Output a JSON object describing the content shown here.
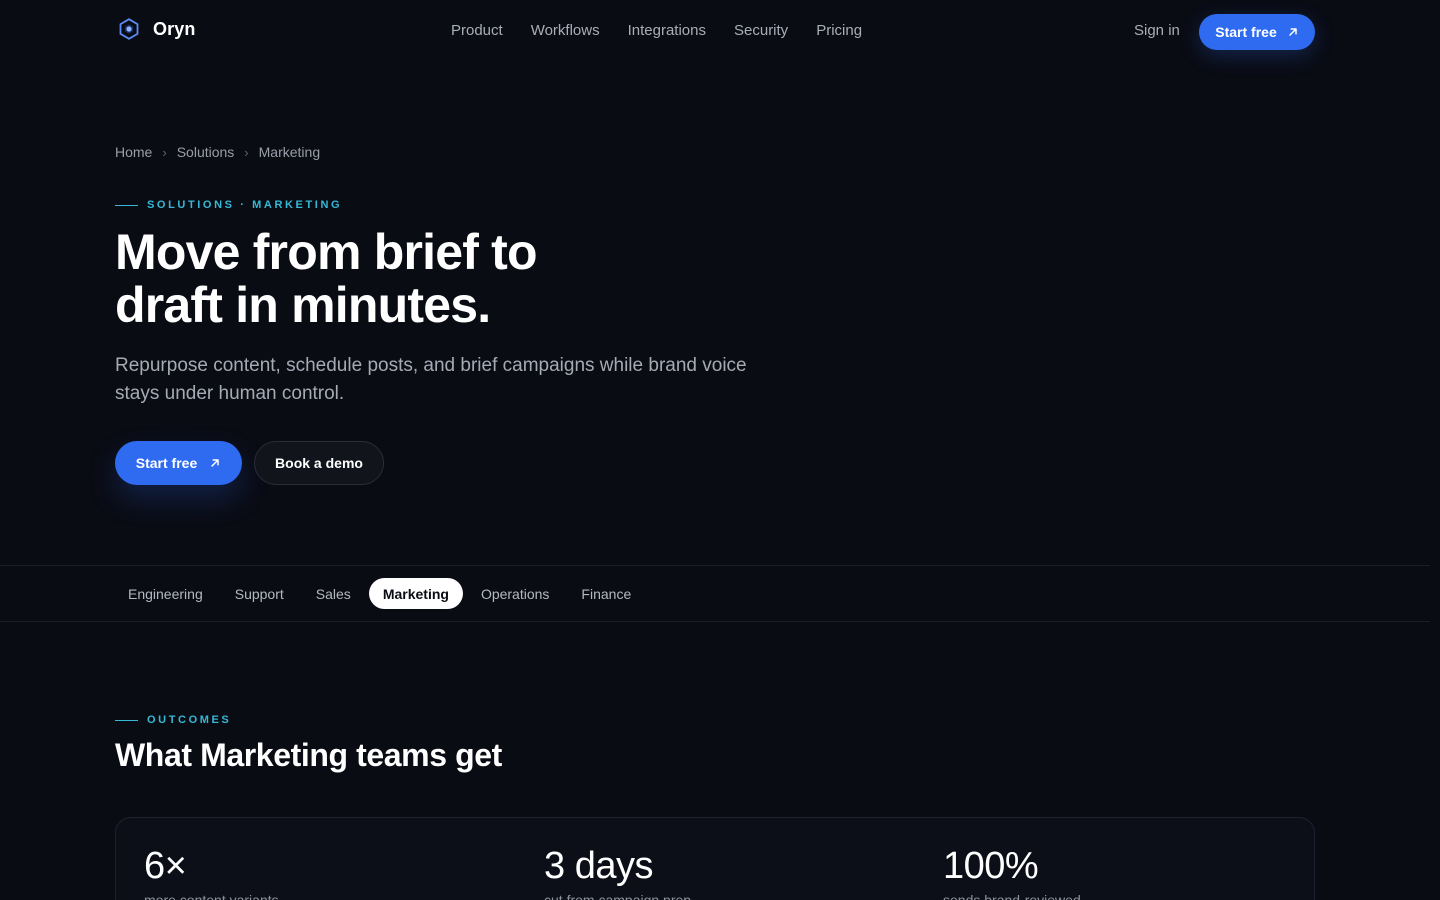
{
  "brand": {
    "name": "Oryn",
    "icon": "hexagon-logo-icon",
    "accent": "#2f6bf0",
    "eyebrow_color": "#35b9d6"
  },
  "nav": {
    "links": [
      "Product",
      "Workflows",
      "Integrations",
      "Security",
      "Pricing"
    ],
    "sign_in": "Sign in",
    "cta": "Start free"
  },
  "breadcrumb": [
    "Home",
    "Solutions",
    "Marketing"
  ],
  "hero": {
    "eyebrow": "SOLUTIONS · MARKETING",
    "title_line1": "Move from brief to",
    "title_line2": "draft in minutes.",
    "subtitle": "Repurpose content, schedule posts, and brief campaigns while brand voice stays under human control.",
    "primary_cta": "Start free",
    "secondary_cta": "Book a demo"
  },
  "tabs": {
    "items": [
      "Engineering",
      "Support",
      "Sales",
      "Marketing",
      "Operations",
      "Finance"
    ],
    "active": "Marketing"
  },
  "outcomes": {
    "eyebrow": "OUTCOMES",
    "title": "What Marketing teams get",
    "stats": [
      {
        "value": "6×",
        "label": "more content variants"
      },
      {
        "value": "3 days",
        "label": "cut from campaign prep"
      },
      {
        "value": "100%",
        "label": "sends brand-reviewed"
      }
    ]
  }
}
